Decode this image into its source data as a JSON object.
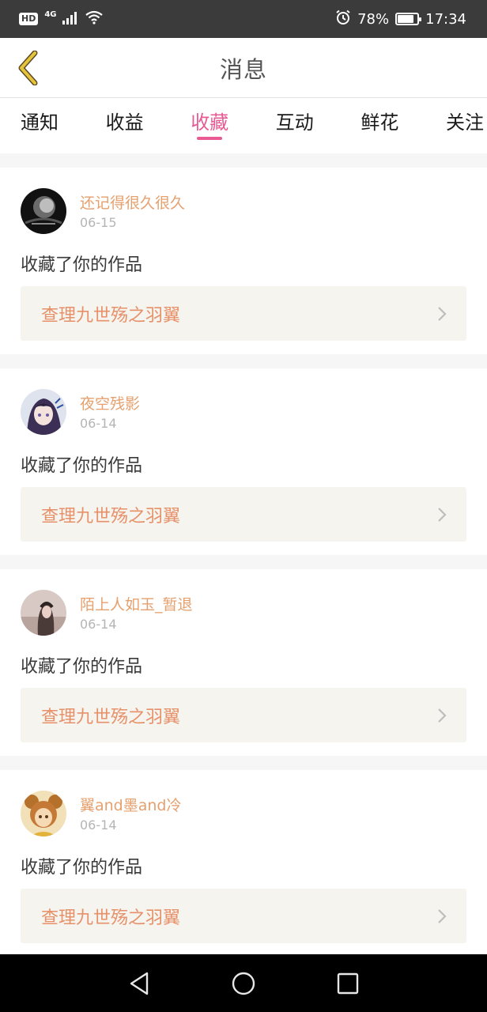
{
  "status_bar": {
    "hd": "HD",
    "network": "4G",
    "battery": "78%",
    "battery_level": 0.78,
    "time": "17:34",
    "icons": [
      "signal-icon",
      "wifi-icon",
      "alarm-icon",
      "battery-icon"
    ]
  },
  "header": {
    "title": "消息",
    "back_icon": "chevron-left-icon"
  },
  "tabs": [
    {
      "label": "通知",
      "active": false
    },
    {
      "label": "收益",
      "active": false
    },
    {
      "label": "收藏",
      "active": true
    },
    {
      "label": "互动",
      "active": false
    },
    {
      "label": "鲜花",
      "active": false
    },
    {
      "label": "关注",
      "active": false
    }
  ],
  "items": [
    {
      "username": "还记得很久很久",
      "date": "06-15",
      "action": "收藏了你的作品",
      "work": "查理九世殇之羽翼"
    },
    {
      "username": "夜空残影",
      "date": "06-14",
      "action": "收藏了你的作品",
      "work": "查理九世殇之羽翼"
    },
    {
      "username": "陌上人如玉_暂退",
      "date": "06-14",
      "action": "收藏了你的作品",
      "work": "查理九世殇之羽翼"
    },
    {
      "username": "翼and墨and冷",
      "date": "06-14",
      "action": "收藏了你的作品",
      "work": "查理九世殇之羽翼"
    }
  ],
  "colors": {
    "accent": "#e75a93",
    "username": "#e5a06e",
    "work_title": "#e6916a",
    "back_icon": "#e6c43a"
  },
  "nav_bar": {
    "icons": [
      "nav-back-icon",
      "nav-home-icon",
      "nav-recents-icon"
    ]
  }
}
